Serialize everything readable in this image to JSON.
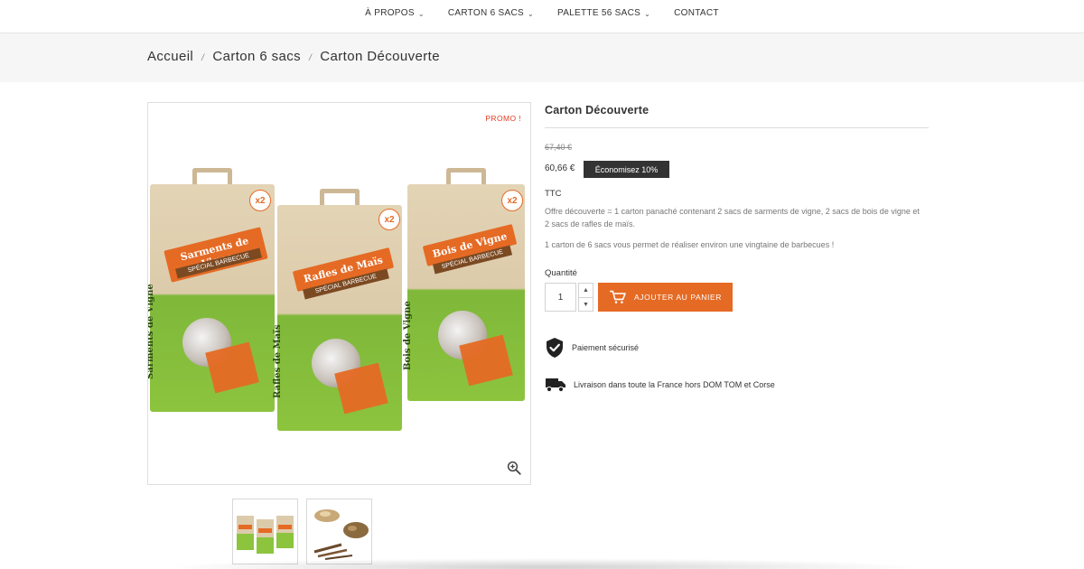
{
  "nav": {
    "items": [
      {
        "label": "À PROPOS",
        "has_dropdown": true
      },
      {
        "label": "CARTON 6 SACS",
        "has_dropdown": true
      },
      {
        "label": "PALETTE 56 SACS",
        "has_dropdown": true
      },
      {
        "label": "CONTACT",
        "has_dropdown": false
      }
    ]
  },
  "breadcrumb": {
    "items": [
      "Accueil",
      "Carton 6 sacs",
      "Carton Découverte"
    ],
    "separator": "/"
  },
  "gallery": {
    "promo_label": "PROMO !",
    "zoom_icon": "zoom-in-icon",
    "bags": [
      {
        "name": "Sarments de Vigne",
        "subtitle": "SPÉCIAL BARBECUE",
        "badge": "x2",
        "side_text": "Sarments de Vigne"
      },
      {
        "name": "Rafles de Maïs",
        "subtitle": "SPÉCIAL BARBECUE",
        "badge": "x2",
        "side_text": "Rafles de Maïs"
      },
      {
        "name": "Bois de Vigne",
        "subtitle": "SPÉCIAL BARBECUE",
        "badge": "x2",
        "side_text": "Bois de Vigne"
      }
    ],
    "thumbnails": [
      "three-bags-thumbnail",
      "wood-pieces-thumbnail"
    ]
  },
  "product": {
    "title": "Carton Découverte",
    "old_price": "67,40 €",
    "price": "60,66 €",
    "discount": "Économisez 10%",
    "tax_label": "TTC",
    "description_1": "Offre découverte = 1 carton panaché contenant 2 sacs de sarments de vigne, 2 sacs de bois de vigne et 2 sacs de rafles de maïs.",
    "description_2": "1 carton de 6 sacs vous permet de réaliser environ une vingtaine de barbecues !",
    "quantity_label": "Quantité",
    "quantity_value": "1",
    "add_to_cart_label": "AJOUTER AU PANIER"
  },
  "reassurance": [
    {
      "icon": "shield-check-icon",
      "label": "Paiement sécurisé"
    },
    {
      "icon": "truck-icon",
      "label": "Livraison dans toute la France hors DOM TOM et Corse"
    }
  ],
  "colors": {
    "accent": "#e56a24",
    "promo": "#e03a1e",
    "discount_bg": "#333333",
    "breadcrumb_bg": "#f6f6f6"
  }
}
